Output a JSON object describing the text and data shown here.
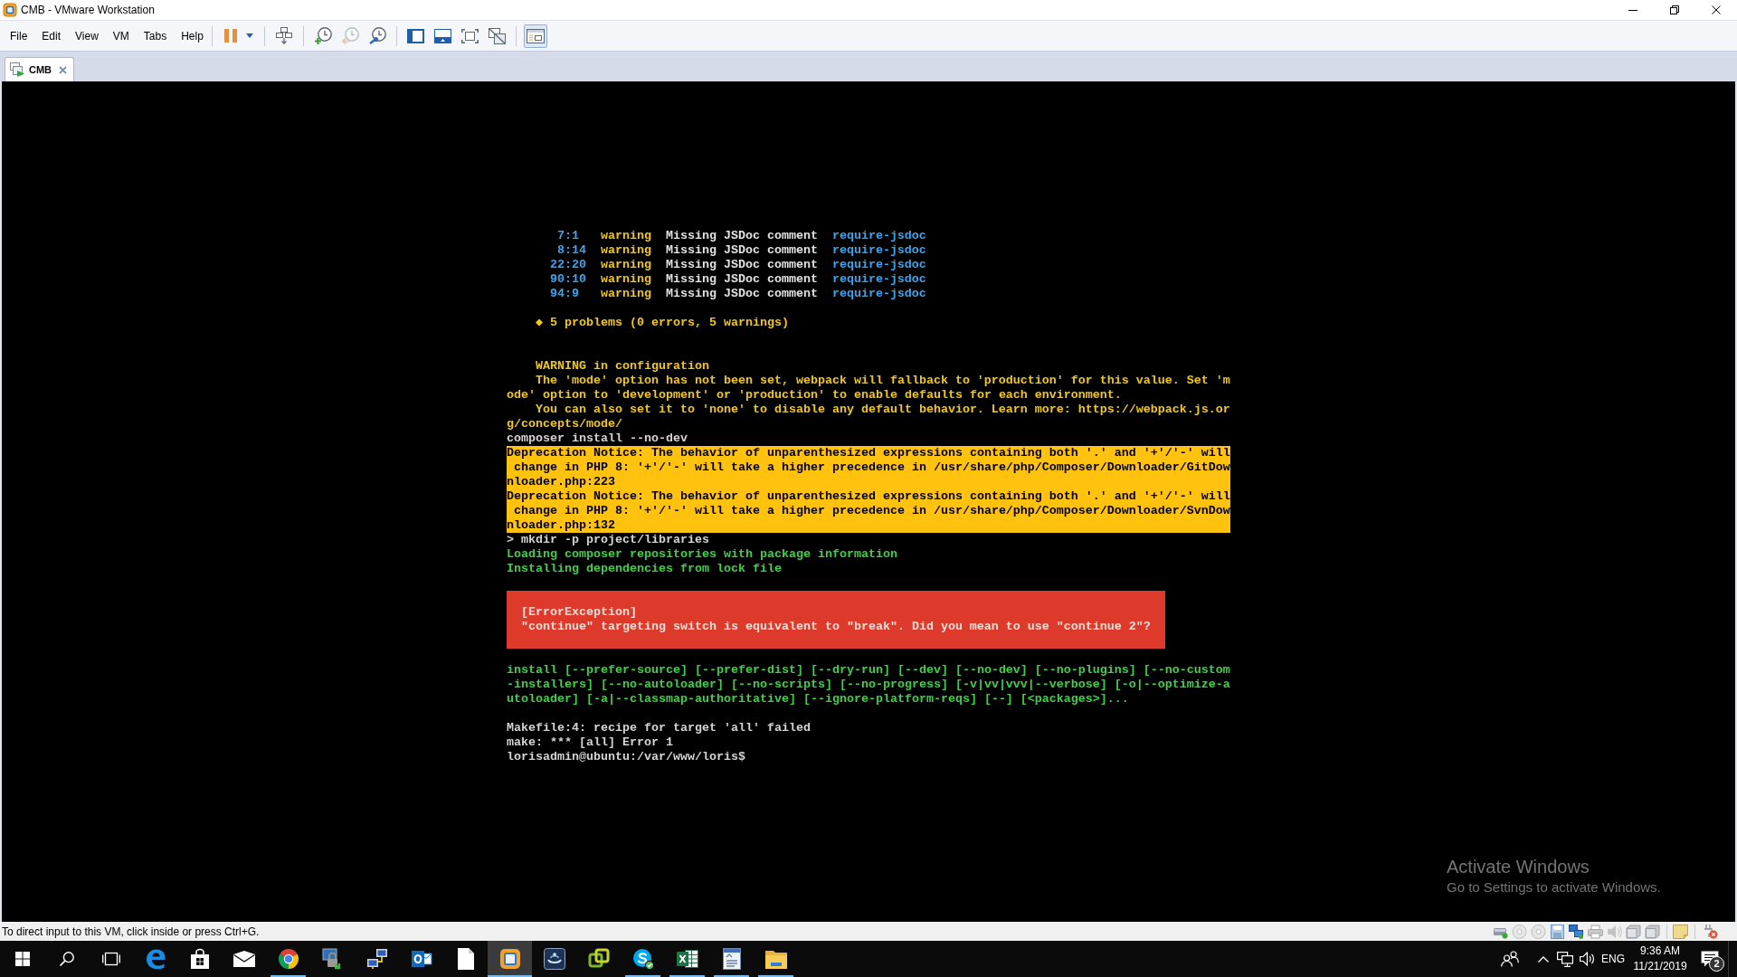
{
  "window": {
    "title": "CMB - VMware Workstation"
  },
  "menu": [
    "File",
    "Edit",
    "View",
    "VM",
    "Tabs",
    "Help"
  ],
  "toolbar": [
    {
      "disabled": false,
      "pressed": false
    },
    {
      "disabled": false,
      "pressed": false
    },
    {
      "disabled": false,
      "pressed": false
    },
    {
      "disabled": false,
      "pressed": false
    },
    {
      "disabled": true,
      "pressed": false
    },
    {
      "disabled": false,
      "pressed": false
    },
    {
      "disabled": false,
      "pressed": false
    },
    {
      "disabled": false,
      "pressed": false
    },
    {
      "disabled": false,
      "pressed": false
    },
    {
      "disabled": false,
      "pressed": false
    },
    {
      "disabled": false,
      "pressed": true
    }
  ],
  "tabs": [
    {
      "label": "CMB",
      "selected": true
    }
  ],
  "terminal": {
    "lint_results": [
      {
        "position": "7:1",
        "severity": "warning",
        "message": "Missing JSDoc comment",
        "rule": "require-jsdoc"
      },
      {
        "position": "8:14",
        "severity": "warning",
        "message": "Missing JSDoc comment",
        "rule": "require-jsdoc"
      },
      {
        "position": "22:20",
        "severity": "warning",
        "message": "Missing JSDoc comment",
        "rule": "require-jsdoc"
      },
      {
        "position": "90:10",
        "severity": "warning",
        "message": "Missing JSDoc comment",
        "rule": "require-jsdoc"
      },
      {
        "position": "94:9",
        "severity": "warning",
        "message": "Missing JSDoc comment",
        "rule": "require-jsdoc"
      }
    ],
    "lint_summary": "◆ 5 problems (0 errors, 5 warnings)",
    "config_warning": {
      "title": "WARNING in configuration",
      "paragraphs": [
        {
          "rows": [
            "The 'mode' option has not been set, webpack will fallback to 'production' for this value. Set 'm",
            "ode' option to 'development' or 'production' to enable defaults for each environment."
          ]
        },
        {
          "rows": [
            "You can also set it to 'none' to disable any default behavior. Learn more: https://webpack.js.or",
            "g/concepts/mode/"
          ]
        }
      ]
    },
    "command": "composer install --no-dev",
    "notices": [
      {
        "rows": [
          "Deprecation Notice: The behavior of unparenthesized expressions containing both '.' and '+'/'-' will",
          " change in PHP 8: '+'/'-' will take a higher precedence in /usr/share/php/Composer/Downloader/GitDow",
          "nloader.php:223"
        ]
      },
      {
        "rows": [
          "Deprecation Notice: The behavior of unparenthesized expressions containing both '.' and '+'/'-' will",
          " change in PHP 8: '+'/'-' will take a higher precedence in /usr/share/php/Composer/Downloader/SvnDow",
          "nloader.php:132"
        ]
      }
    ],
    "script_line": "> mkdir -p project/libraries",
    "info": [
      "Loading composer repositories with package information",
      "Installing dependencies from lock file"
    ],
    "exception": {
      "title": "[ErrorException]",
      "message": "\"continue\" targeting switch is equivalent to \"break\". Did you mean to use \"continue 2\"?"
    },
    "usage": [
      "install [--prefer-source] [--prefer-dist] [--dry-run] [--dev] [--no-dev] [--no-plugins] [--no-custom",
      "-installers] [--no-autoloader] [--no-scripts] [--no-progress] [-v|vv|vvv|--verbose] [-o|--optimize-a",
      "utoloader] [-a|--classmap-authoritative] [--ignore-platform-reqs] [--] [<packages>]..."
    ],
    "make_output": [
      "Makefile:4: recipe for target 'all' failed",
      "make: *** [all] Error 1"
    ],
    "prompt": "lorisadmin@ubuntu:/var/www/loris$"
  },
  "activation_notice": {
    "title": "Activate Windows",
    "message": "Go to Settings to activate Windows."
  },
  "status_bar": {
    "message": "To direct input to this VM, click inside or press Ctrl+G."
  },
  "taskbar": {
    "apps": [
      {
        "running": false,
        "selected": false
      },
      {
        "running": false,
        "selected": false
      },
      {
        "running": false,
        "selected": false
      },
      {
        "running": true,
        "selected": false
      },
      {
        "running": false,
        "selected": false
      },
      {
        "running": false,
        "selected": false
      },
      {
        "running": false,
        "selected": false
      },
      {
        "running": false,
        "selected": false
      },
      {
        "running": true,
        "selected": true
      },
      {
        "running": false,
        "selected": false
      },
      {
        "running": false,
        "selected": false
      },
      {
        "running": true,
        "selected": false
      },
      {
        "running": true,
        "selected": false
      },
      {
        "running": true,
        "selected": false
      },
      {
        "running": true,
        "selected": false
      }
    ],
    "language": "ENG",
    "time": "9:36 AM",
    "date": "11/21/2019",
    "notifications": "2"
  }
}
